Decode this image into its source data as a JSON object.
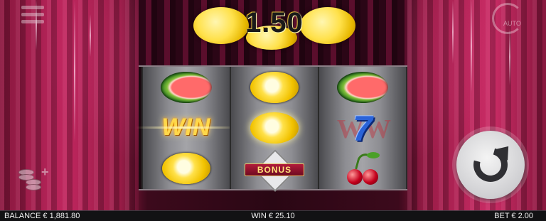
{
  "win_display": {
    "amount": "1.50"
  },
  "reels": [
    [
      "watermelon",
      "win",
      "lemon"
    ],
    [
      "lemon",
      "lemon",
      "bonus"
    ],
    [
      "watermelon",
      "seven",
      "cherries"
    ]
  ],
  "symbols": {
    "win_label": "WIN",
    "seven_label": "7",
    "seven_wild_text": "W W",
    "bonus_label": "BONUS"
  },
  "controls": {
    "auto_label": "AUTO"
  },
  "status_bar": {
    "balance": "BALANCE € 1,881.80",
    "win": "WIN € 25.10",
    "bet": "BET € 2.00"
  },
  "colors": {
    "curtain": "#b8245a",
    "lemon": "#ffe14a",
    "seven": "#2a63d8",
    "status_bg": "#121214"
  }
}
